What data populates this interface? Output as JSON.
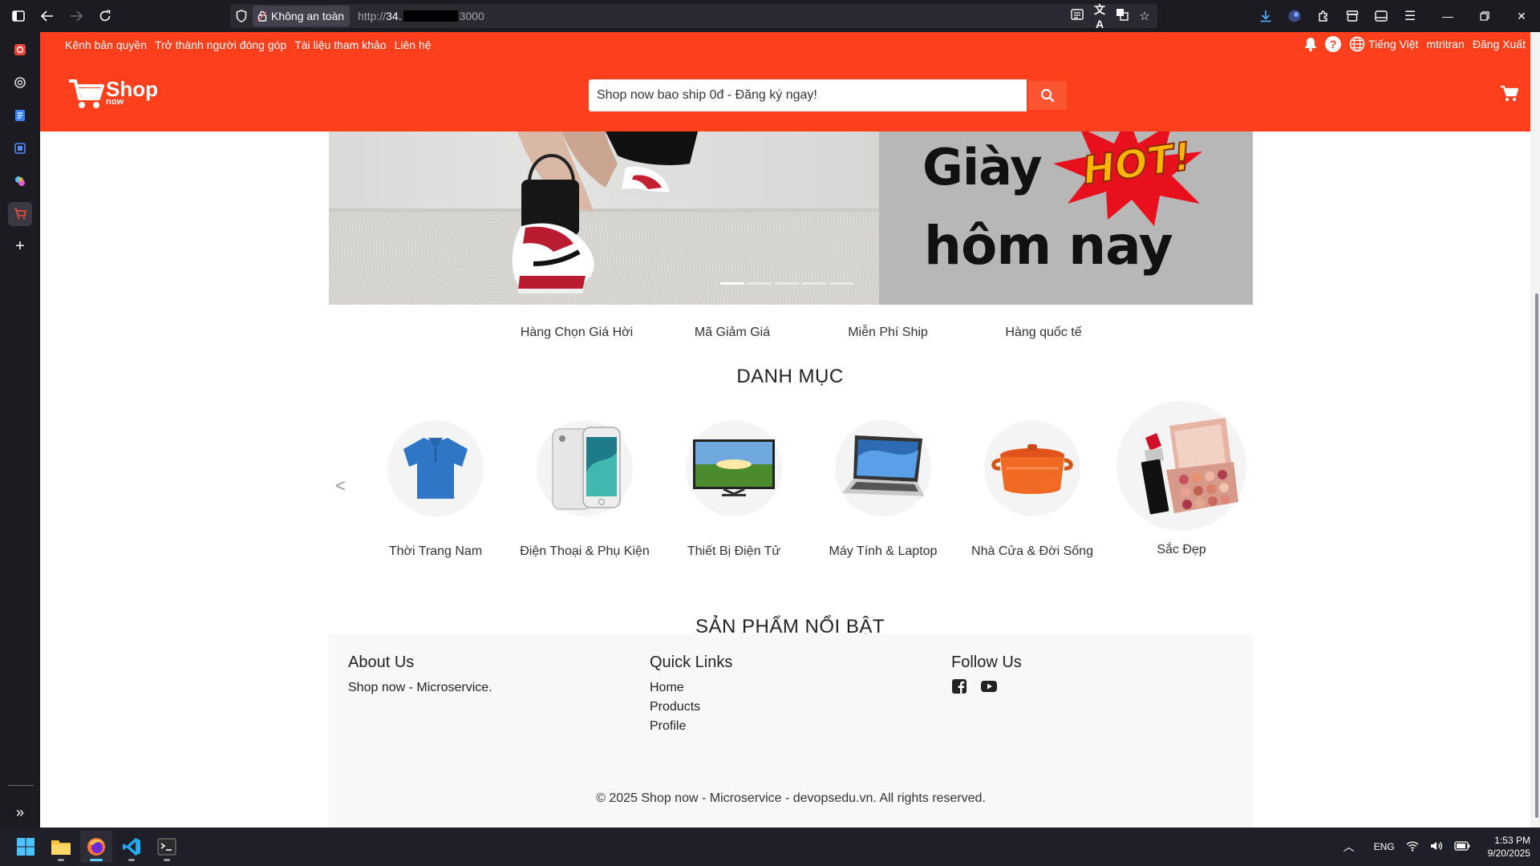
{
  "browser": {
    "security_label": "Không an toàn",
    "url_protocol": "http://",
    "url_host_visible": "34.",
    "url_port": "3000"
  },
  "header": {
    "top_links": [
      "Kênh bản quyền",
      "Trở thành người đóng góp",
      "Tài liệu tham khảo",
      "Liên hệ"
    ],
    "language": "Tiếng Việt",
    "username": "mtritran",
    "logout": "Đăng Xuất",
    "logo_main": "Shop",
    "logo_sub": "now",
    "search_placeholder": "Shop now bao ship 0đ - Đăng ký ngay!",
    "brand_color": "#fd3f1c"
  },
  "banner": {
    "line1": "Giày",
    "line2": "hôm nay",
    "hot": "HOT!",
    "slides": 5,
    "active_slide": 1
  },
  "promo": [
    "Hàng Chọn Giá Hời",
    "Mã Giảm Giá",
    "Miễn Phí Ship",
    "Hàng quốc tế"
  ],
  "categories": {
    "title": "DANH MỤC",
    "prev": "<",
    "next": ">",
    "items": [
      {
        "label": "Thời Trang Nam",
        "icon": "shirt-icon"
      },
      {
        "label": "Điện Thoại & Phụ Kiện",
        "icon": "phone-icon"
      },
      {
        "label": "Thiết Bị Điện Tử",
        "icon": "tv-icon"
      },
      {
        "label": "Máy Tính & Laptop",
        "icon": "laptop-icon"
      },
      {
        "label": "Nhà Cửa & Đời Sống",
        "icon": "pot-icon"
      },
      {
        "label": "Sắc Đẹp",
        "icon": "lipstick-icon"
      }
    ]
  },
  "featured_title": "SẢN PHẨM NỔI BẬT",
  "footer": {
    "about_title": "About Us",
    "about_text": "Shop now - Microservice.",
    "links_title": "Quick Links",
    "links": [
      "Home",
      "Products",
      "Profile"
    ],
    "follow_title": "Follow Us",
    "copyright": "© 2025 Shop now - Microservice - devopsedu.vn. All rights reserved."
  },
  "taskbar": {
    "lang": "ENG",
    "time": "1:53 PM",
    "date": "9/20/2025"
  }
}
